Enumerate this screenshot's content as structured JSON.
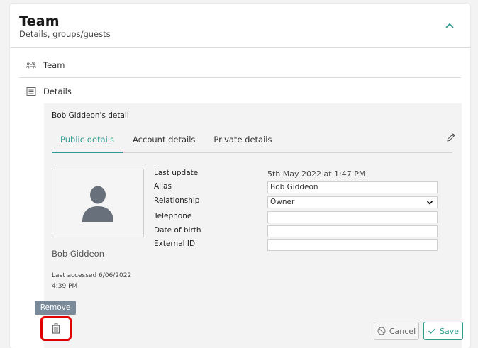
{
  "card": {
    "title": "Team",
    "subtitle": "Details, groups/guests",
    "collapse_icon": "chevron-up-icon"
  },
  "nav": {
    "team_label": "Team",
    "team_icon": "group-icon",
    "details_label": "Details",
    "details_icon": "list-icon"
  },
  "detail": {
    "title": "Bob Giddeon's detail",
    "tabs": [
      {
        "label": "Public details",
        "active": true
      },
      {
        "label": "Account details",
        "active": false
      },
      {
        "label": "Private details",
        "active": false
      }
    ],
    "edit_icon": "pencil-icon",
    "person_name": "Bob Giddeon",
    "last_accessed": "Last accessed 6/06/2022 4:39 PM",
    "fields": {
      "last_update_label": "Last update",
      "last_update_value": "5th May 2022 at 1:47 PM",
      "alias_label": "Alias",
      "alias_value": "Bob Giddeon",
      "relationship_label": "Relationship",
      "relationship_value": "Owner",
      "telephone_label": "Telephone",
      "telephone_value": "",
      "dob_label": "Date of birth",
      "dob_value": "",
      "external_id_label": "External ID",
      "external_id_value": ""
    },
    "cancel_label": "Cancel",
    "save_label": "Save"
  },
  "remove": {
    "tooltip": "Remove",
    "icon": "trash-icon"
  },
  "colors": {
    "accent": "#2d9c8f",
    "highlight": "#e00000",
    "tooltip_bg": "#7a8a99"
  }
}
